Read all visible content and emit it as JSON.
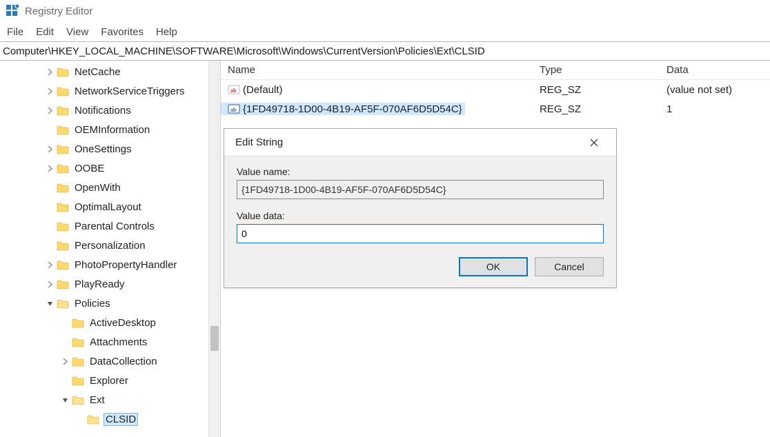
{
  "titlebar": {
    "title": "Registry Editor"
  },
  "menubar": {
    "items": [
      "File",
      "Edit",
      "View",
      "Favorites",
      "Help"
    ]
  },
  "address": "Computer\\HKEY_LOCAL_MACHINE\\SOFTWARE\\Microsoft\\Windows\\CurrentVersion\\Policies\\Ext\\CLSID",
  "tree": {
    "items": [
      {
        "label": "NetCache",
        "indent": 2,
        "chev": ">"
      },
      {
        "label": "NetworkServiceTriggers",
        "indent": 2,
        "chev": ">"
      },
      {
        "label": "Notifications",
        "indent": 2,
        "chev": ">"
      },
      {
        "label": "OEMInformation",
        "indent": 2,
        "chev": ""
      },
      {
        "label": "OneSettings",
        "indent": 2,
        "chev": ">"
      },
      {
        "label": "OOBE",
        "indent": 2,
        "chev": ">"
      },
      {
        "label": "OpenWith",
        "indent": 2,
        "chev": ""
      },
      {
        "label": "OptimalLayout",
        "indent": 2,
        "chev": ""
      },
      {
        "label": "Parental Controls",
        "indent": 2,
        "chev": ""
      },
      {
        "label": "Personalization",
        "indent": 2,
        "chev": ""
      },
      {
        "label": "PhotoPropertyHandler",
        "indent": 2,
        "chev": ">"
      },
      {
        "label": "PlayReady",
        "indent": 2,
        "chev": ">"
      },
      {
        "label": "Policies",
        "indent": 2,
        "chev": "v"
      },
      {
        "label": "ActiveDesktop",
        "indent": 3,
        "chev": ""
      },
      {
        "label": "Attachments",
        "indent": 3,
        "chev": ""
      },
      {
        "label": "DataCollection",
        "indent": 3,
        "chev": ">"
      },
      {
        "label": "Explorer",
        "indent": 3,
        "chev": ""
      },
      {
        "label": "Ext",
        "indent": 3,
        "chev": "v"
      },
      {
        "label": "CLSID",
        "indent": 4,
        "chev": "",
        "selected": true
      }
    ]
  },
  "list": {
    "columns": {
      "name": "Name",
      "type": "Type",
      "data": "Data"
    },
    "rows": [
      {
        "name": "(Default)",
        "type": "REG_SZ",
        "data": "(value not set)",
        "selected": false
      },
      {
        "name": "{1FD49718-1D00-4B19-AF5F-070AF6D5D54C}",
        "type": "REG_SZ",
        "data": "1",
        "selected": true
      }
    ]
  },
  "dialog": {
    "title": "Edit String",
    "name_label": "Value name:",
    "name_value": "{1FD49718-1D00-4B19-AF5F-070AF6D5D54C}",
    "data_label": "Value data:",
    "data_value": "0",
    "ok": "OK",
    "cancel": "Cancel"
  }
}
